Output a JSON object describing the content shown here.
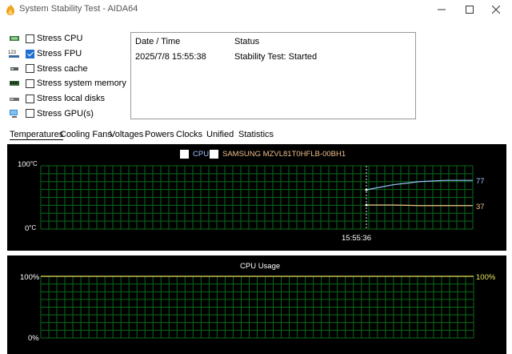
{
  "window": {
    "title": "System Stability Test - AIDA64"
  },
  "stress": [
    {
      "label": "Stress CPU",
      "checked": false,
      "icon": "cpu-chip-icon"
    },
    {
      "label": "Stress FPU",
      "checked": true,
      "icon": "fpu-123-icon"
    },
    {
      "label": "Stress cache",
      "checked": false,
      "icon": "cache-chip-icon"
    },
    {
      "label": "Stress system memory",
      "checked": false,
      "icon": "memory-module-icon"
    },
    {
      "label": "Stress local disks",
      "checked": false,
      "icon": "disk-icon"
    },
    {
      "label": "Stress GPU(s)",
      "checked": false,
      "icon": "gpu-monitor-icon"
    }
  ],
  "status": {
    "col_date": "Date / Time",
    "col_status": "Status",
    "rows": [
      {
        "datetime": "2025/7/8 15:55:38",
        "status": "Stability Test: Started"
      }
    ]
  },
  "tabs": [
    "Temperatures",
    "Cooling Fans",
    "Voltages",
    "Powers",
    "Clocks",
    "Unified",
    "Statistics"
  ],
  "active_tab": "Temperatures",
  "temp_chart": {
    "legend": [
      {
        "label": "CPU",
        "color": "#9ec4ff",
        "checked": true
      },
      {
        "label": "SAMSUNG MZVL81T0HFLB-00BH1",
        "color": "#f0c08c",
        "checked": true
      }
    ],
    "y_max_label": "100",
    "y_min_label": "0",
    "y_unit": "°C",
    "time_label": "15:55:36",
    "cpu_value_label": "77",
    "ssd_value_label": "37",
    "colors": {
      "grid": "#0a6b1a",
      "cpu": "#9ec4ff",
      "ssd": "#f0c08c",
      "marker": "#d8ffd8"
    }
  },
  "chart_data": [
    {
      "type": "line",
      "title": "",
      "ylabel": "°C",
      "ylim": [
        0,
        100
      ],
      "x": [
        "15:55:36"
      ],
      "series": [
        {
          "name": "CPU",
          "values": [
            62,
            70,
            75,
            77,
            77
          ]
        },
        {
          "name": "SAMSUNG MZVL81T0HFLB-00BH1",
          "values": [
            38,
            38,
            37,
            37,
            37
          ]
        }
      ]
    },
    {
      "type": "line",
      "title": "CPU Usage",
      "ylim": [
        0,
        100
      ],
      "series": [
        {
          "name": "CPU Usage",
          "values": [
            100
          ]
        }
      ]
    }
  ],
  "usage_chart": {
    "title": "CPU Usage",
    "y_max_label": "100%",
    "y_min_label": "0%",
    "value_label": "100%",
    "colors": {
      "grid": "#0a6b1a",
      "line": "#e8e85a"
    }
  }
}
